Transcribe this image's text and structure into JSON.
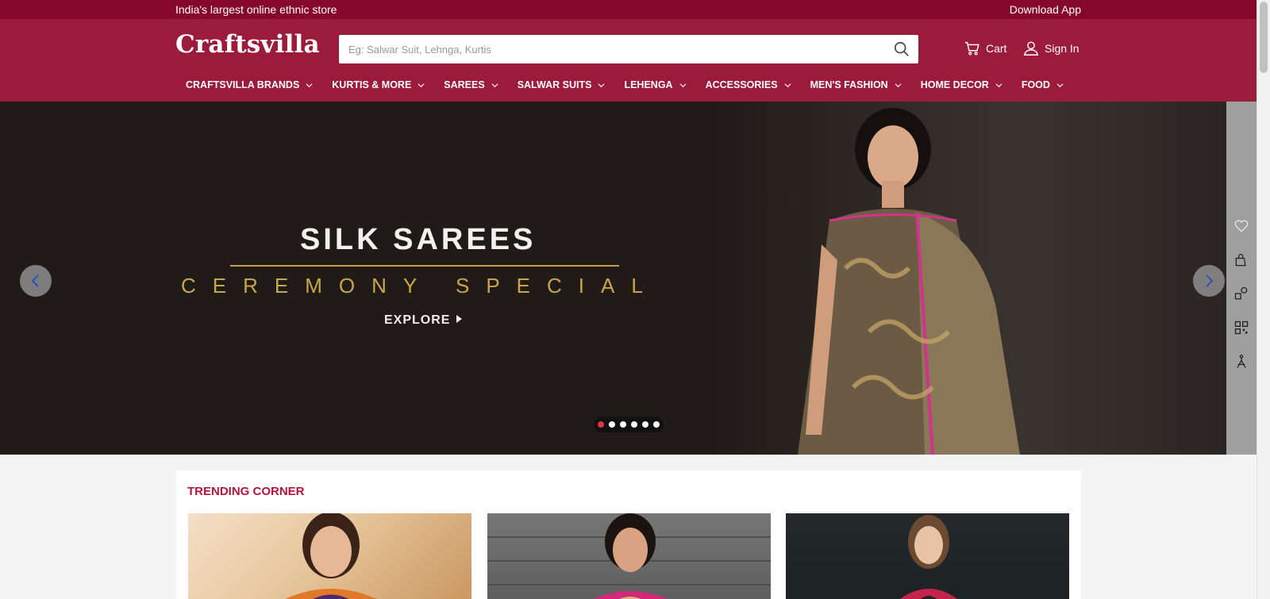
{
  "topbar": {
    "tagline": "India's largest online ethnic store",
    "download": "Download App"
  },
  "header": {
    "logo": "Craftsvilla",
    "search_placeholder": "Eg: Salwar Suit, Lehnga, Kurtis",
    "cart_label": "Cart",
    "signin_label": "Sign In"
  },
  "nav": [
    {
      "label": "CRAFTSVILLA BRANDS"
    },
    {
      "label": "KURTIS & MORE"
    },
    {
      "label": "SAREES"
    },
    {
      "label": "SALWAR SUITS"
    },
    {
      "label": "LEHENGA"
    },
    {
      "label": "ACCESSORIES"
    },
    {
      "label": "MEN'S FASHION"
    },
    {
      "label": "HOME DECOR"
    },
    {
      "label": "FOOD"
    }
  ],
  "hero": {
    "title": "SILK SAREES",
    "subtitle": "CEREMONY SPECIAL",
    "cta": "EXPLORE",
    "slides": 6,
    "active_slide": 1
  },
  "rail_icons": [
    "heart-icon",
    "shopping-bag-icon",
    "track-order-icon",
    "qr-code-icon",
    "tailor-icon"
  ],
  "trending": {
    "heading": "TRENDING CORNER"
  },
  "colors": {
    "topbar": "#86092b",
    "header": "#9c1a3a",
    "accent": "#b4143a",
    "gold": "#c9a64b"
  }
}
